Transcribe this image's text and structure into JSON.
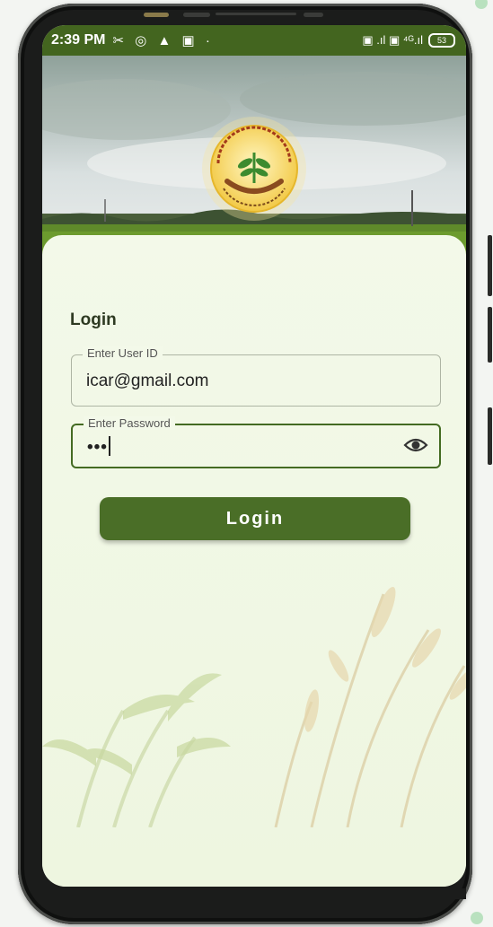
{
  "status_bar": {
    "time": "2:39 PM",
    "left_icons": "✂ ◎ ▲ ▣ ·",
    "right_icons": "▣ .ıl ▣ ⁴ᴳ.ıl",
    "battery": "53"
  },
  "login": {
    "title": "Login",
    "user_field": {
      "label": "Enter User ID",
      "value": "icar@gmail.com"
    },
    "password_field": {
      "label": "Enter Password",
      "value": "•••"
    },
    "button_label": "Login"
  },
  "colors": {
    "primary_green": "#4a6e27",
    "background": "#f1f7e6"
  }
}
